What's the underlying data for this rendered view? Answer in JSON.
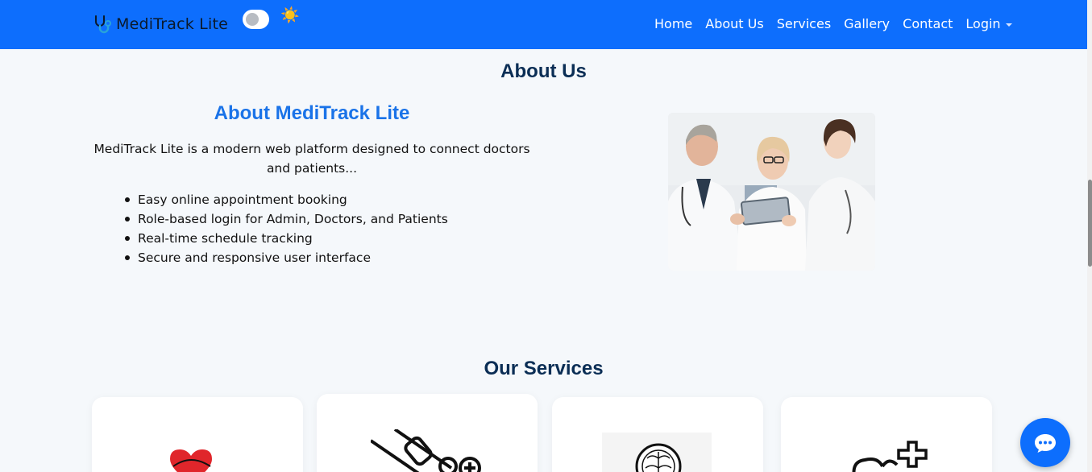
{
  "navbar": {
    "brand": "MediTrack Lite",
    "theme_icon": "sun-icon",
    "links": [
      {
        "label": "Home"
      },
      {
        "label": "About Us"
      },
      {
        "label": "Services"
      },
      {
        "label": "Gallery"
      },
      {
        "label": "Contact"
      },
      {
        "label": "Login"
      }
    ],
    "accent_color": "#0d6efd"
  },
  "about": {
    "section_title": "About Us",
    "subtitle": "About MediTrack Lite",
    "description": "MediTrack Lite is a modern web platform designed to connect doctors and patients...",
    "features": [
      "Easy online appointment booking",
      "Role-based login for Admin, Doctors, and Patients",
      "Real-time schedule tracking",
      "Secure and responsive user interface"
    ]
  },
  "services": {
    "section_title": "Our Services",
    "cards": [
      {
        "icon": "heart-icon"
      },
      {
        "icon": "syringe-icon"
      },
      {
        "icon": "brain-icon"
      },
      {
        "icon": "lungs-icon"
      }
    ]
  },
  "chat": {
    "icon": "chat-icon"
  },
  "colors": {
    "title": "#0b2e55",
    "subtitle": "#1a73e8",
    "background": "#f5f8fb"
  }
}
